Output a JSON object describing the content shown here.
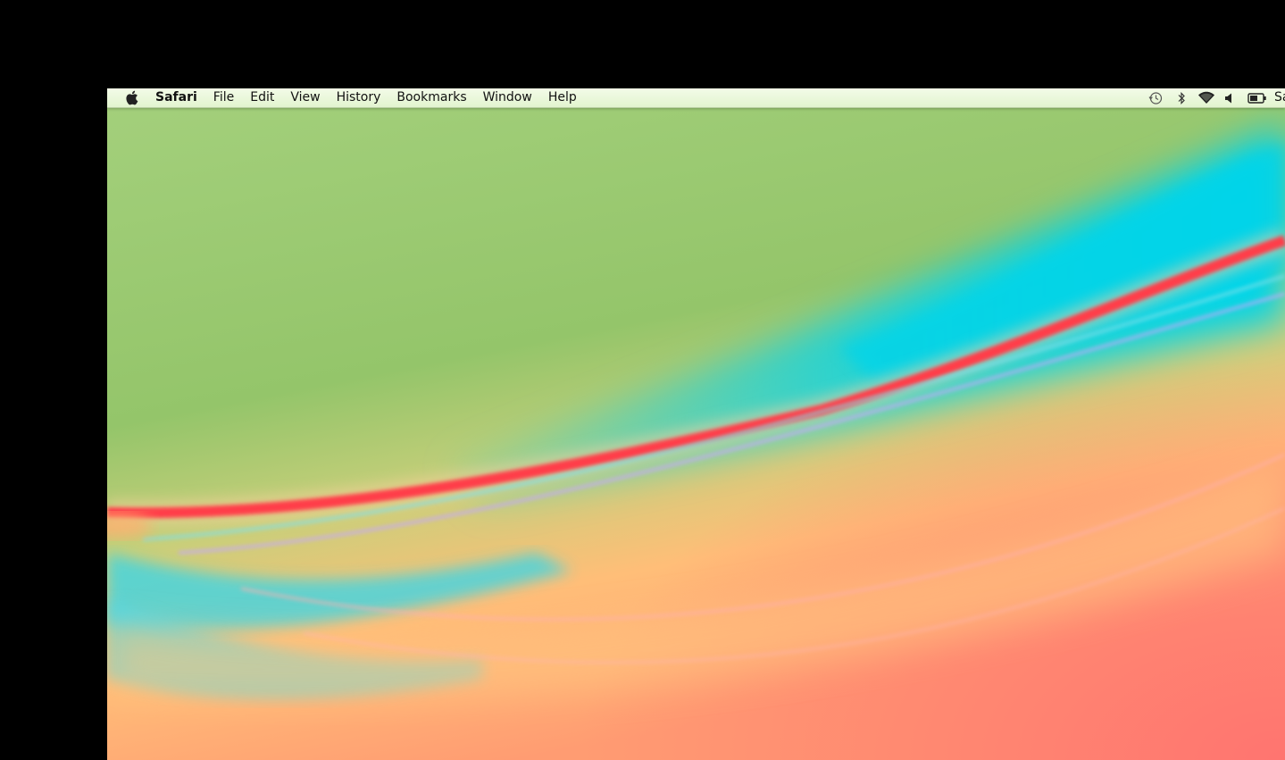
{
  "menubar": {
    "apple_icon": "apple-icon",
    "app_name": "Safari",
    "menus": [
      "File",
      "Edit",
      "View",
      "History",
      "Bookmarks",
      "Window",
      "Help"
    ],
    "status_icons": [
      "time-machine-icon",
      "bluetooth-icon",
      "wifi-icon",
      "volume-icon",
      "battery-icon"
    ],
    "status_text": "Sa"
  },
  "colors": {
    "menubar_bg": "#e8f6d6",
    "wallpaper_green": "#9ccc74",
    "wallpaper_cyan": "#00d2ea",
    "wallpaper_red": "#ff4444",
    "wallpaper_orange": "#ffa870",
    "frame": "#000000"
  }
}
